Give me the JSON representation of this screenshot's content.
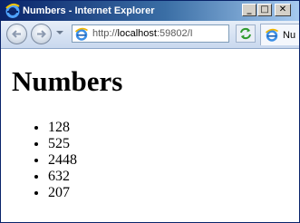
{
  "window": {
    "title": "Numbers - Internet Explorer",
    "buttons": {
      "minimize": "_",
      "maximize": "□",
      "close": "✕"
    }
  },
  "toolbar": {
    "address": {
      "prefix": "http://",
      "host": "localhost",
      "rest": ":59802/I"
    },
    "tab_label": "Nu"
  },
  "page": {
    "heading": "Numbers",
    "items": [
      "128",
      "525",
      "2448",
      "632",
      "207"
    ]
  },
  "colors": {
    "title_bar": "#0a246a",
    "accent": "#3a6ea5"
  }
}
